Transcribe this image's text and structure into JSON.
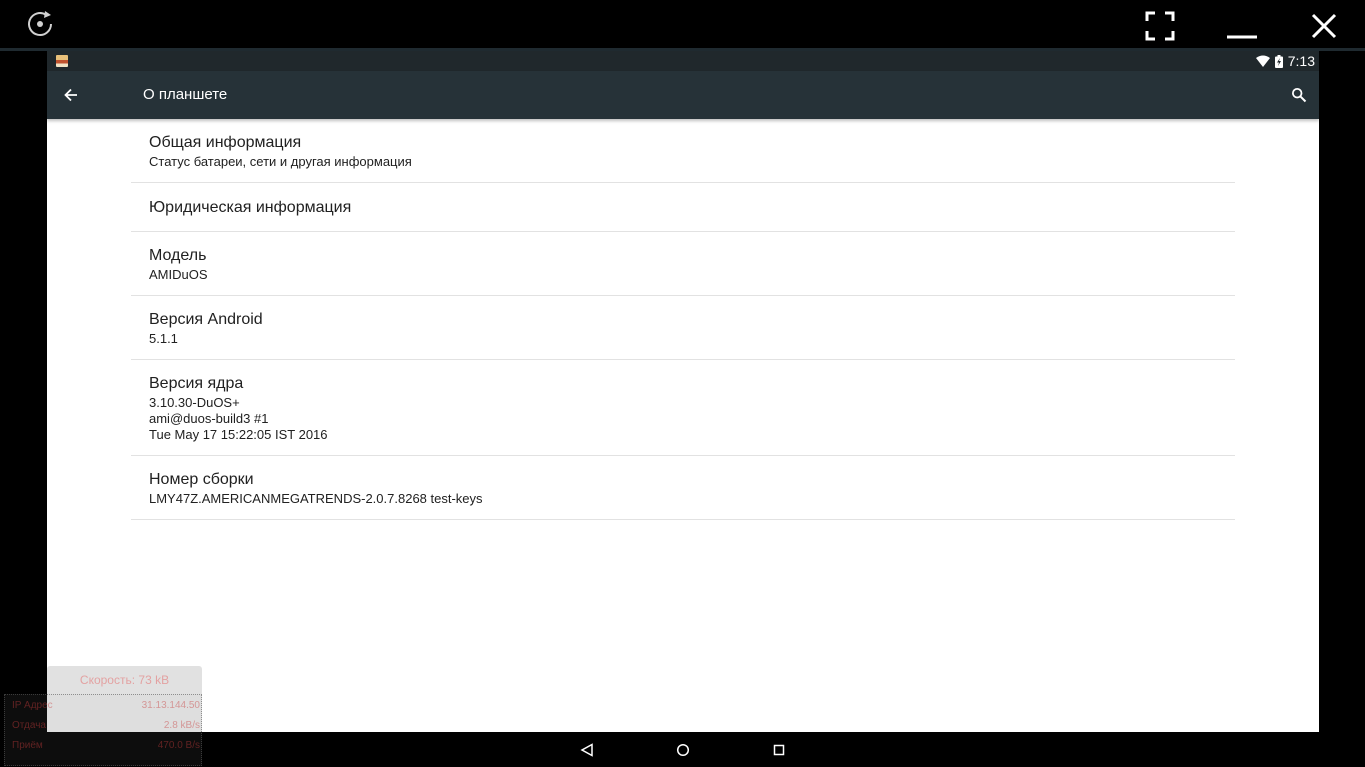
{
  "window": {
    "rotate_icon": "rotate-icon",
    "fullscreen_icon": "fullscreen-icon",
    "minimize_icon": "minimize-icon",
    "close_icon": "close-icon"
  },
  "status_bar": {
    "time": "7:13",
    "icons": [
      "notification-image-icon",
      "wifi-icon",
      "battery-charging-icon"
    ]
  },
  "app_bar": {
    "title": "О планшете",
    "back_icon": "arrow-back-icon",
    "search_icon": "search-icon",
    "background": "#263238"
  },
  "items": [
    {
      "title": "Общая информация",
      "summary": "Статус батареи, сети и другая информация"
    },
    {
      "title": "Юридическая информация",
      "summary": ""
    },
    {
      "title": "Модель",
      "summary": "AMIDuOS"
    },
    {
      "title": "Версия Android",
      "summary": "5.1.1"
    },
    {
      "title": "Версия ядра",
      "summary": "3.10.30-DuOS+\nami@duos-build3 #1\nTue May 17 15:22:05 IST 2016"
    },
    {
      "title": "Номер сборки",
      "summary": "LMY47Z.AMERICANMEGATRENDS-2.0.7.8268 test-keys"
    }
  ],
  "nav_bar": {
    "icons": [
      "nav-back-icon",
      "nav-home-icon",
      "nav-recents-icon"
    ]
  },
  "net_widget": {
    "header": "Скорость: 73 kB",
    "rows": [
      {
        "label": "IP Адрес",
        "value": "31.13.144.50"
      },
      {
        "label": "Отдача",
        "value": "2.8 kB/s"
      },
      {
        "label": "Приём",
        "value": "470.0 B/s"
      }
    ]
  }
}
